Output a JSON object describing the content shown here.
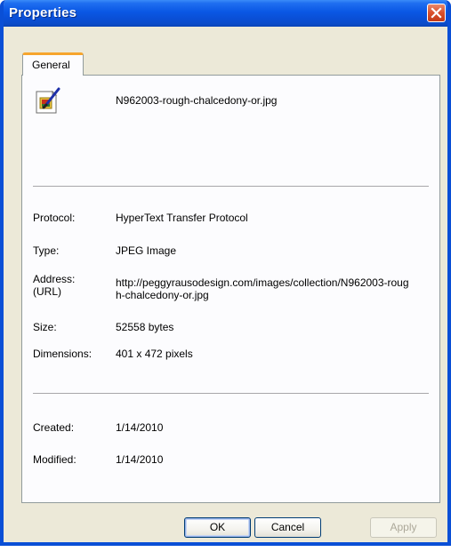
{
  "window": {
    "title": "Properties"
  },
  "tabs": [
    {
      "label": "General",
      "selected": true
    }
  ],
  "file": {
    "icon": "jpeg-image-file-icon",
    "name": "N962003-rough-chalcedony-or.jpg"
  },
  "details": {
    "protocol_label": "Protocol:",
    "protocol_value": "HyperText Transfer Protocol",
    "type_label": "Type:",
    "type_value": "JPEG Image",
    "address_label": "Address:\n(URL)",
    "address_value": "http://peggyrausodesign.com/images/collection/N962003-rough-chalcedony-or.jpg",
    "size_label": "Size:",
    "size_value": "52558 bytes",
    "dimensions_label": "Dimensions:",
    "dimensions_value": "401 x 472 pixels"
  },
  "dates": {
    "created_label": "Created:",
    "created_value": "1/14/2010",
    "modified_label": "Modified:",
    "modified_value": "1/14/2010"
  },
  "buttons": {
    "ok_label": "OK",
    "cancel_label": "Cancel",
    "apply_label": "Apply"
  },
  "colors": {
    "titlebar": "#0a4fd6",
    "tab_highlight": "#f6a52d",
    "dialog_face": "#ece9d8",
    "close_button": "#d9502b"
  }
}
